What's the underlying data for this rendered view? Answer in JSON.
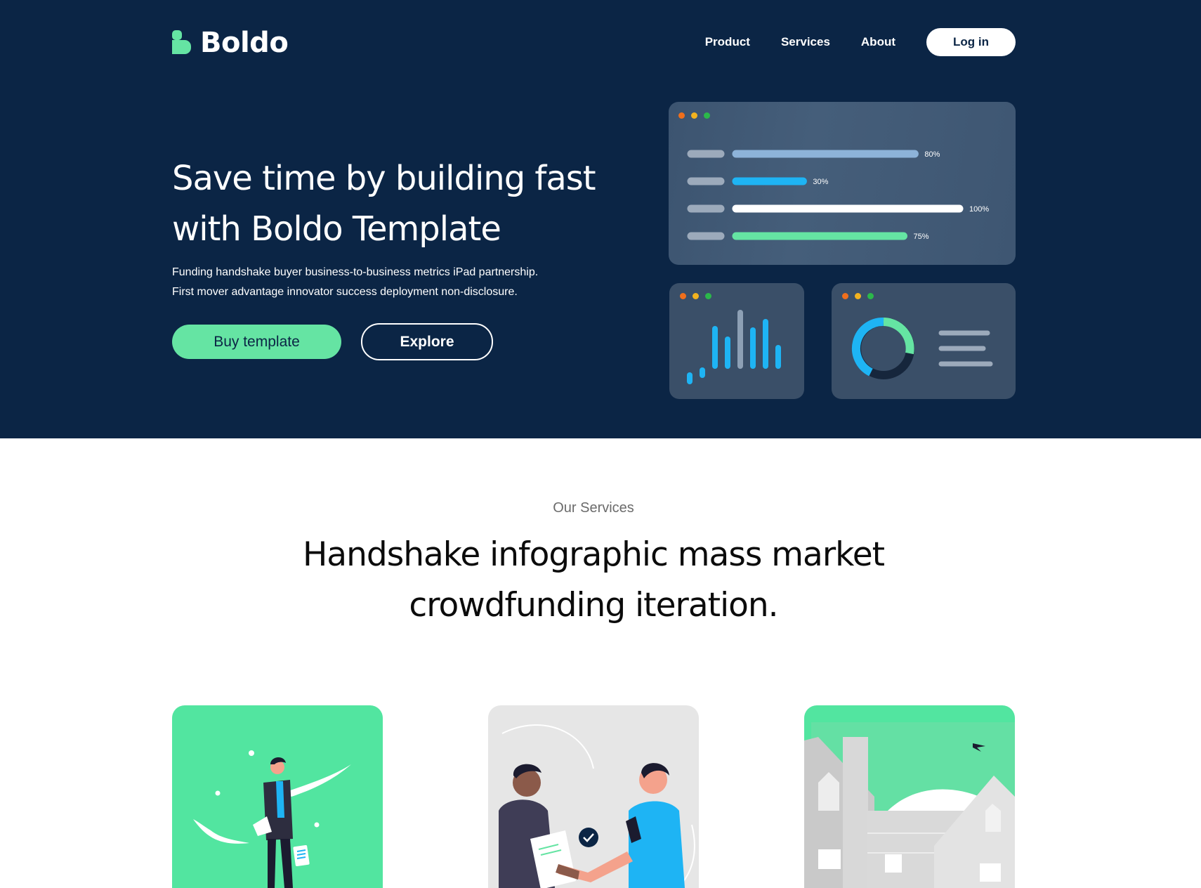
{
  "brand": {
    "name": "Boldo",
    "accent": "#65E4A3",
    "navy": "#0B2545"
  },
  "nav": {
    "items": [
      {
        "label": "Product"
      },
      {
        "label": "Services"
      },
      {
        "label": "About"
      }
    ],
    "login_label": "Log in"
  },
  "hero": {
    "title_line1": "Save time by building fast",
    "title_line2": "with Boldo Template",
    "subtitle_line1": "Funding handshake buyer business-to-business metrics iPad partnership.",
    "subtitle_line2": "First mover advantage innovator success deployment non-disclosure.",
    "buy_label": "Buy template",
    "explore_label": "Explore"
  },
  "dashboard": {
    "bars": [
      {
        "percent_label": "80%",
        "value": 80,
        "color": "#8DB3D9"
      },
      {
        "percent_label": "30%",
        "value": 30,
        "color": "#1EB4F4"
      },
      {
        "percent_label": "100%",
        "value": 100,
        "color": "#FFFFFF"
      },
      {
        "percent_label": "75%",
        "value": 75,
        "color": "#65E4A3"
      }
    ],
    "window_dot_colors": [
      "#F06F1C",
      "#F2B21F",
      "#2BB84A"
    ]
  },
  "services": {
    "eyebrow": "Our Services",
    "title_line1": "Handshake infographic mass market",
    "title_line2": "crowdfunding iteration."
  }
}
